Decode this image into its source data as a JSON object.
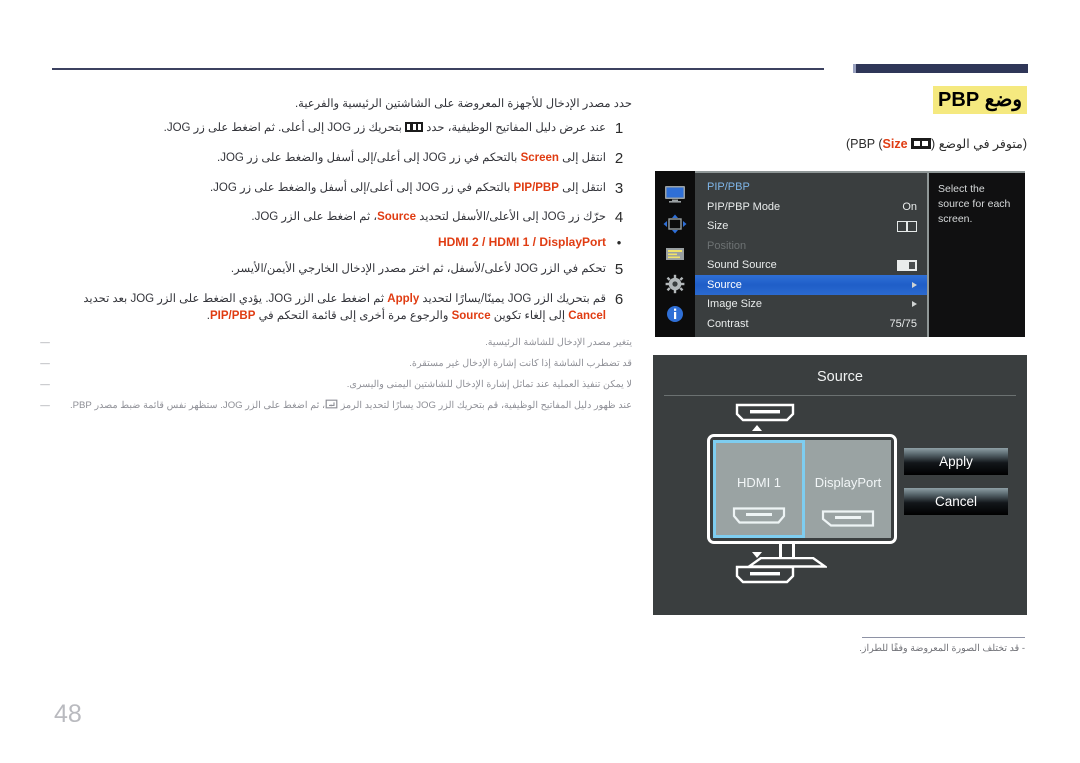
{
  "page": {
    "number": "48",
    "title": "وضع PBP",
    "subtitle_pre": "(متوفر في الوضع PBP (",
    "subtitle_hl": "Size",
    "subtitle_post": "))"
  },
  "instructions": {
    "intro": "حدد مصدر الإدخال للأجهزة المعروضة على الشاشتين الرئيسية والفرعية.",
    "steps": [
      {
        "num": "1",
        "pre": "عند عرض دليل المفاتيح الوظيفية، حدد ",
        "post": " بتحريك زر JOG إلى أعلى. ثم اضغط على زر JOG."
      },
      {
        "num": "2",
        "pre": "انتقل إلى ",
        "hl": "Screen",
        "post": " بالتحكم في زر JOG إلى أعلى/إلى أسفل والضغط على زر JOG."
      },
      {
        "num": "3",
        "pre": "انتقل إلى ",
        "hl": "PIP/PBP",
        "post": " بالتحكم في زر JOG إلى أعلى/إلى أسفل والضغط على زر JOG."
      },
      {
        "num": "4",
        "pre": "حرّك زر JOG إلى الأعلى/الأسفل لتحديد ",
        "hl": "Source",
        "post": "، ثم اضغط على الزر JOG."
      },
      {
        "num": "5",
        "pre": "تحكم في الزر JOG لأعلى/لأسفل، ثم اختر مصدر الإدخال الخارجي الأيمن/الأيسر.",
        "hl": "",
        "post": ""
      }
    ],
    "bullet": {
      "marker": "•",
      "text": "HDMI 2 / HDMI 1 / DisplayPort"
    },
    "step6": {
      "num": "6",
      "p1": "قم بتحريك الزر JOG يمينًا/يسارًا لتحديد ",
      "hl1": "Apply",
      "p2": " ثم اضغط على الزر JOG. يؤدي الضغط على الزر JOG بعد تحديد ",
      "hl2": "Cancel",
      "p3": " إلى إلغاء تكوين ",
      "hl3": "Source",
      "p4": " والرجوع مرة أخرى إلى قائمة التحكم في ",
      "hl4": "PIP/PBP",
      "p5": "."
    },
    "notes": [
      {
        "dash": "―",
        "text": "يتغير مصدر الإدخال للشاشة الرئيسية."
      },
      {
        "dash": "―",
        "text": "قد تضطرب الشاشة إذا كانت إشارة الإدخال غير مستقرة."
      },
      {
        "dash": "―",
        "text": "لا يمكن تنفيذ العملية عند تماثل إشارة الإدخال للشاشتين اليمنى واليسرى."
      },
      {
        "dash": "―",
        "pre": "عند ظهور دليل المفاتيح الوظيفية، قم بتحريك الزر JOG يسارًا لتحديد الرمز ",
        "post": "، ثم اضغط على الزر JOG. ستظهر نفس قائمة ضبط مصدر PBP."
      }
    ]
  },
  "osd": {
    "icons": [
      "monitor-icon",
      "pip-pbp-icon",
      "onscreen-display-icon",
      "system-gear-icon",
      "information-icon"
    ],
    "heading": "PIP/PBP",
    "rows": [
      {
        "label": "PIP/PBP Mode",
        "value": "On",
        "type": "text",
        "state": "normal"
      },
      {
        "label": "Size",
        "value": "",
        "type": "size-glyph",
        "state": "normal"
      },
      {
        "label": "Position",
        "value": "",
        "type": "none",
        "state": "disabled"
      },
      {
        "label": "Sound Source",
        "value": "",
        "type": "sound-glyph",
        "state": "normal"
      },
      {
        "label": "Source",
        "value": "",
        "type": "arrow",
        "state": "selected"
      },
      {
        "label": "Image Size",
        "value": "",
        "type": "arrow",
        "state": "normal"
      },
      {
        "label": "Contrast",
        "value": "75/75",
        "type": "text",
        "state": "normal"
      }
    ],
    "help": "Select the source for each screen."
  },
  "source_dialog": {
    "title": "Source",
    "panes": [
      {
        "label": "HDMI 1",
        "connector": "hdmi-connector-icon",
        "selected": true
      },
      {
        "label": "DisplayPort",
        "connector": "displayport-connector-icon",
        "selected": false
      }
    ],
    "buttons": [
      {
        "label": "Apply"
      },
      {
        "label": "Cancel"
      }
    ],
    "note": "- قد تختلف الصورة المعروضة وفقًا للطراز."
  },
  "colors": {
    "accent_red": "#e03c12",
    "title_highlight": "#f5e97f",
    "rule_navy": "#2f3658",
    "osd_selected_blue": "#2f6fd6",
    "pane_highlight": "#7ecdf0"
  }
}
